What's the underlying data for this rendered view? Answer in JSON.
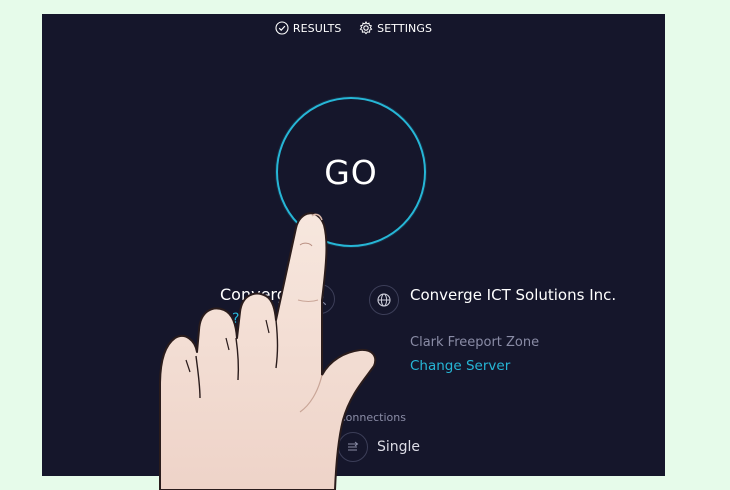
{
  "nav": {
    "results_label": "RESULTS",
    "settings_label": "SETTINGS"
  },
  "go_button": {
    "label": "GO"
  },
  "isp": {
    "name": "Converge",
    "sub": "?"
  },
  "server": {
    "name": "Converge ICT Solutions Inc.",
    "location": "Clark Freeport Zone",
    "change_label": "Change Server"
  },
  "connections": {
    "label": "Connections",
    "value": "Single"
  },
  "colors": {
    "background": "#15162b",
    "accent": "#26b6d6",
    "page": "#e6fbea"
  },
  "icons": [
    "check-circle-icon",
    "gear-icon",
    "user-icon",
    "globe-icon",
    "connections-icon",
    "pointing-hand"
  ]
}
